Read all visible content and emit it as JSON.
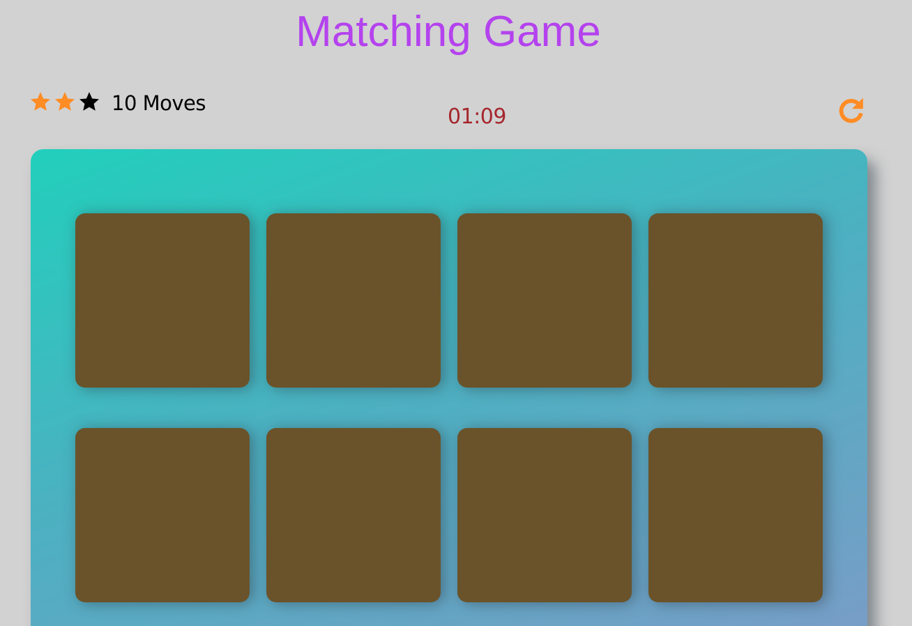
{
  "title": "Matching Game",
  "score_panel": {
    "stars": [
      {
        "icon": "star-icon",
        "filled": true,
        "color": "#ff8c24"
      },
      {
        "icon": "star-icon",
        "filled": true,
        "color": "#ff8c24"
      },
      {
        "icon": "star-icon",
        "filled": false,
        "color": "#000000"
      }
    ],
    "moves_count": "10",
    "moves_label": "10 Moves",
    "timer": "01:09",
    "restart_icon": "restart-icon"
  },
  "colors": {
    "background": "#d2d2d2",
    "title": "#b442ee",
    "timer": "#a5272d",
    "accent": "#ff8c24",
    "card_back": "#6a532a",
    "deck_gradient_start": "#22cfbc",
    "deck_gradient_end": "#7a9cc7"
  },
  "deck": {
    "cards": [
      {
        "state": "face-down"
      },
      {
        "state": "face-down"
      },
      {
        "state": "face-down"
      },
      {
        "state": "face-down"
      },
      {
        "state": "face-down"
      },
      {
        "state": "face-down"
      },
      {
        "state": "face-down"
      },
      {
        "state": "face-down"
      }
    ]
  }
}
